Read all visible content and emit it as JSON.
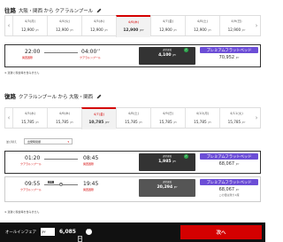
{
  "outbound": {
    "title": "往路",
    "route": "大阪・関西 から クアラルンプール",
    "dates": [
      {
        "date": "4/3(月)",
        "price": "12,900",
        "unit": "JPY"
      },
      {
        "date": "4/4(火)",
        "price": "12,900",
        "unit": "JPY"
      },
      {
        "date": "4/5(水)",
        "price": "12,900",
        "unit": "JPY"
      },
      {
        "date": "4/6(木)",
        "price": "12,900",
        "unit": "JPY"
      },
      {
        "date": "4/7(金)",
        "price": "12,900",
        "unit": "JPY"
      },
      {
        "date": "4/8(土)",
        "price": "12,900",
        "unit": "JPY"
      },
      {
        "date": "4/9(日)",
        "price": "12,900",
        "unit": "JPY"
      }
    ],
    "flight": {
      "dep_time": "22:00",
      "dep_apt": "関西国際",
      "arr_time": "04:00",
      "arr_day": "+1",
      "arr_apt": "クアラルンプール",
      "fare_label": "通常運賃",
      "fare_price": "4,100",
      "fare_unit": "JPY",
      "premium_label": "プレミアムフラットベッド",
      "premium_price": "70,952",
      "premium_unit": "JPY"
    },
    "note": "※ 運賃に税金等を含みません"
  },
  "inbound": {
    "title": "復路",
    "route": "クアラルンプール から 大阪・関西",
    "dates": [
      {
        "date": "4/5(水)",
        "price": "15,785",
        "unit": "JPY"
      },
      {
        "date": "4/6(木)",
        "price": "15,785",
        "unit": "JPY"
      },
      {
        "date": "4/7(金)",
        "price": "10,785",
        "unit": "JPY"
      },
      {
        "date": "4/8(土)",
        "price": "15,785",
        "unit": "JPY"
      },
      {
        "date": "4/9(日)",
        "price": "15,785",
        "unit": "JPY"
      },
      {
        "date": "4/10(月)",
        "price": "15,785",
        "unit": "JPY"
      },
      {
        "date": "4/11(火)",
        "price": "15,785",
        "unit": "JPY"
      }
    ],
    "filter_label": "並び替え",
    "filter_value": "出発時間順",
    "flights": [
      {
        "dep_time": "01:20",
        "dep_apt": "クアラルンプール",
        "arr_time": "08:45",
        "arr_apt": "関西国際",
        "fare_label": "通常運賃",
        "fare_price": "1,985",
        "fare_unit": "JPY",
        "premium_label": "プレミアムフラットベッド",
        "premium_price": "68,067",
        "premium_unit": "JPY"
      },
      {
        "dep_time": "09:55",
        "dep_apt": "クアラルンプール",
        "stop": "1",
        "carrier": "JAL",
        "arr_time": "19:45",
        "arr_apt": "関西国際",
        "fare_label": "通常運賃",
        "fare_price": "20,294",
        "fare_unit": "JPY",
        "premium_label": "プレミアムフラットベッド",
        "premium_price": "68,067",
        "premium_unit": "JPY",
        "premium_sub": "この便は残り1席"
      }
    ],
    "note": "※ 運賃に税金等を含みません"
  },
  "footer": {
    "label": "オールインフェア",
    "currency": "JPY",
    "total": "6,085",
    "next": "次へ"
  },
  "colors": {
    "accent": "#d40000",
    "premium": "#6c4ed6",
    "fare": "#555555",
    "check": "#2fa84f"
  }
}
